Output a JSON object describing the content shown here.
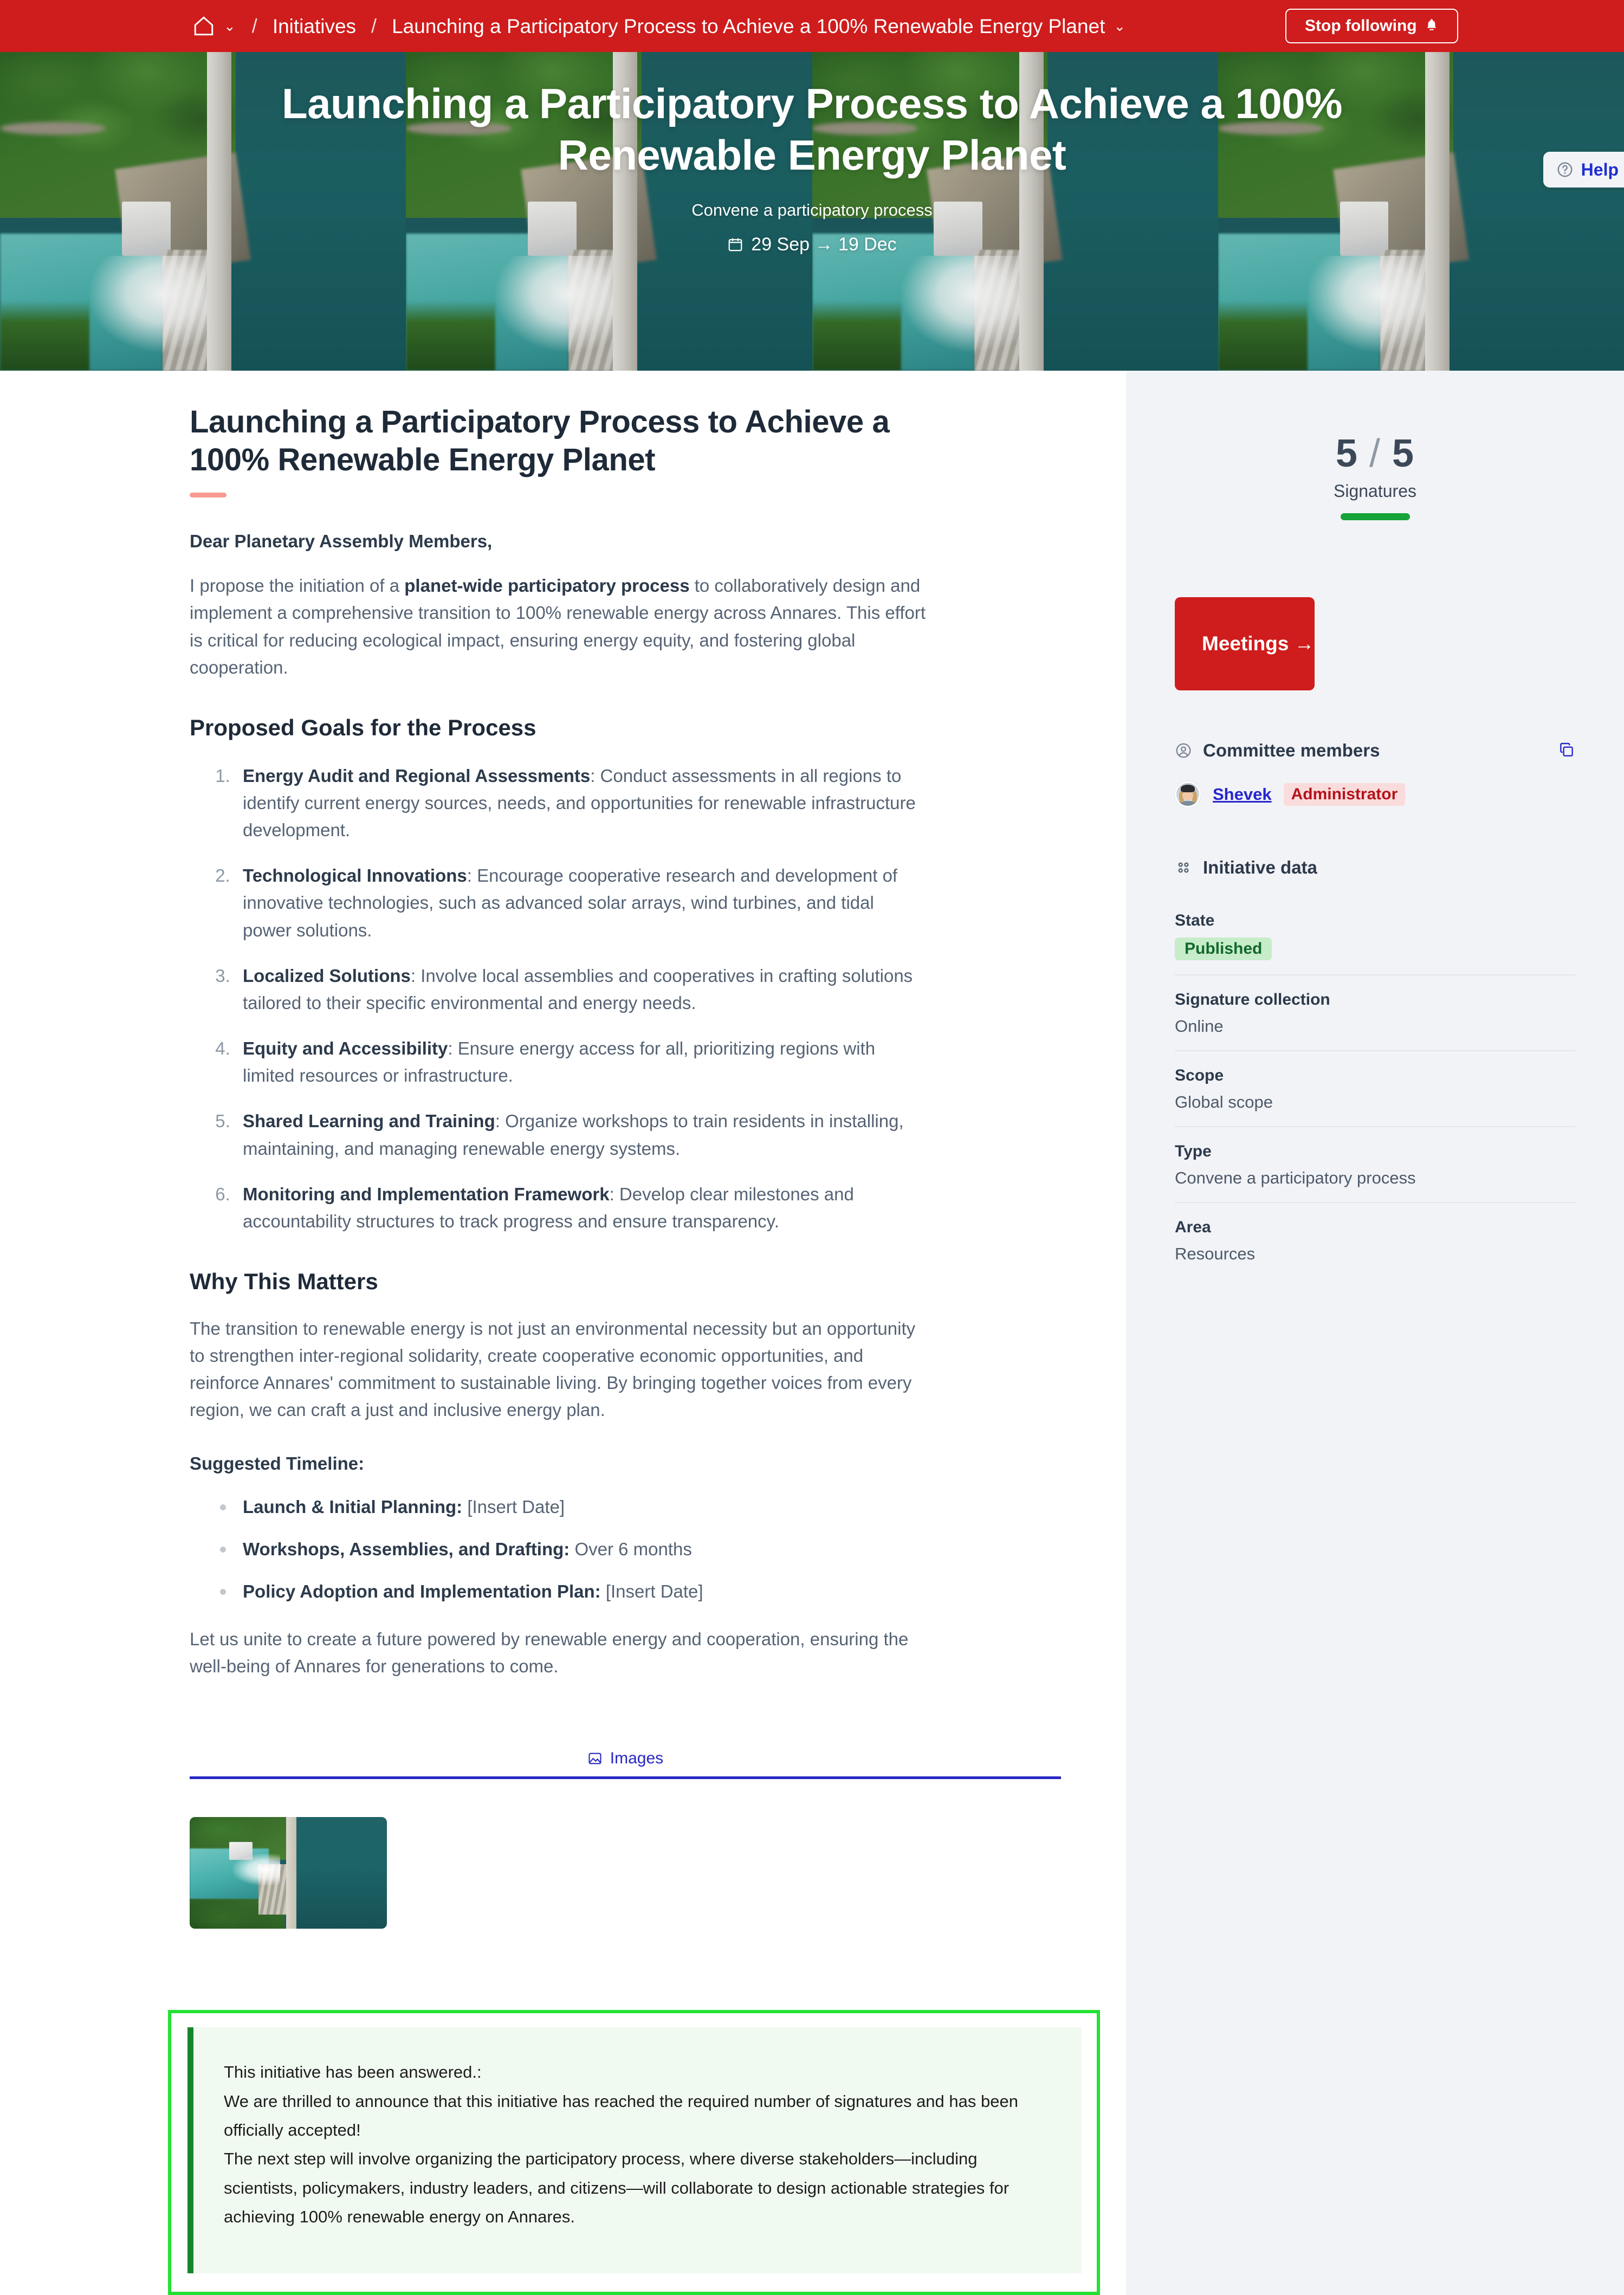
{
  "topbar": {
    "home_label": "Home",
    "dropdown_caret": "⌄",
    "separator": "/",
    "breadcrumb_initiatives": "Initiatives",
    "breadcrumb_current": "Launching a Participatory Process to Achieve a 100% Renewable Energy Planet",
    "breadcrumb_caret": "⌄",
    "follow_button": "Stop following"
  },
  "help": {
    "label": "Help"
  },
  "hero": {
    "title": "Launching a Participatory Process to Achieve a 100% Renewable Energy Planet",
    "subtitle": "Convene a participatory process",
    "dates": "29 Sep → 19 Dec"
  },
  "main": {
    "title": "Launching a Participatory Process to Achieve a 100% Renewable Energy Planet",
    "salutation": "Dear Planetary Assembly Members,",
    "intro_pre": "I propose the initiation of a ",
    "intro_bold": "planet-wide participatory process",
    "intro_post": " to collaboratively design and implement a comprehensive transition to 100% renewable energy across Annares. This effort is critical for reducing ecological impact, ensuring energy equity, and fostering global cooperation.",
    "goals_heading": "Proposed Goals for the Process",
    "goals": [
      {
        "term": "Energy Audit and Regional Assessments",
        "desc": ": Conduct assessments in all regions to identify current energy sources, needs, and opportunities for renewable infrastructure development."
      },
      {
        "term": "Technological Innovations",
        "desc": ": Encourage cooperative research and development of innovative technologies, such as advanced solar arrays, wind turbines, and tidal power solutions."
      },
      {
        "term": "Localized Solutions",
        "desc": ": Involve local assemblies and cooperatives in crafting solutions tailored to their specific environmental and energy needs."
      },
      {
        "term": "Equity and Accessibility",
        "desc": ": Ensure energy access for all, prioritizing regions with limited resources or infrastructure."
      },
      {
        "term": "Shared Learning and Training",
        "desc": ": Organize workshops to train residents in installing, maintaining, and managing renewable energy systems."
      },
      {
        "term": "Monitoring and Implementation Framework",
        "desc": ": Develop clear milestones and accountability structures to track progress and ensure transparency."
      }
    ],
    "why_heading": "Why This Matters",
    "why_body": "The transition to renewable energy is not just an environmental necessity but an opportunity to strengthen inter-regional solidarity, create cooperative economic opportunities, and reinforce Annares' commitment to sustainable living. By bringing together voices from every region, we can craft a just and inclusive energy plan.",
    "timeline_heading": "Suggested Timeline:",
    "timeline": [
      {
        "term": "Launch & Initial Planning:",
        "desc": " [Insert Date]"
      },
      {
        "term": "Workshops, Assemblies, and Drafting:",
        "desc": " Over 6 months"
      },
      {
        "term": "Policy Adoption and Implementation Plan:",
        "desc": " [Insert Date]"
      }
    ],
    "closing": "Let us unite to create a future powered by renewable energy and cooperation, ensuring the well-being of Annares for generations to come."
  },
  "images_section": {
    "tab_label": "Images"
  },
  "answer": {
    "line1": "This initiative has been answered.:",
    "line2": "We are thrilled to announce that this initiative has reached the required number of signatures and has been officially accepted!",
    "line3": "The next step will involve organizing the participatory process, where diverse stakeholders—including scientists, policymakers, industry leaders, and citizens—will collaborate to design actionable strategies for achieving 100% renewable energy on Annares."
  },
  "sidebar": {
    "signatures": {
      "current": "5",
      "slash": "/",
      "goal": "5",
      "label": "Signatures",
      "progress_percent": 100,
      "progress_color": "#16a338"
    },
    "meetings_button": "Meetings →",
    "committee": {
      "heading": "Committee members",
      "members": [
        {
          "name": "Shevek",
          "role": "Administrator"
        }
      ]
    },
    "initiative_data": {
      "heading": "Initiative data",
      "rows": [
        {
          "key": "State",
          "value": "Published",
          "badge": true
        },
        {
          "key": "Signature collection",
          "value": "Online",
          "badge": false
        },
        {
          "key": "Scope",
          "value": "Global scope",
          "badge": false
        },
        {
          "key": "Type",
          "value": "Convene a participatory process",
          "badge": false
        },
        {
          "key": "Area",
          "value": "Resources",
          "badge": false
        }
      ]
    }
  },
  "colors": {
    "brand_red": "#cf1c1c",
    "sidebar_bg": "#f2f3f7",
    "accent_blue": "#2626cd",
    "success_green": "#16a338",
    "answer_border": "#23e033",
    "title_rule": "#f79a90"
  }
}
